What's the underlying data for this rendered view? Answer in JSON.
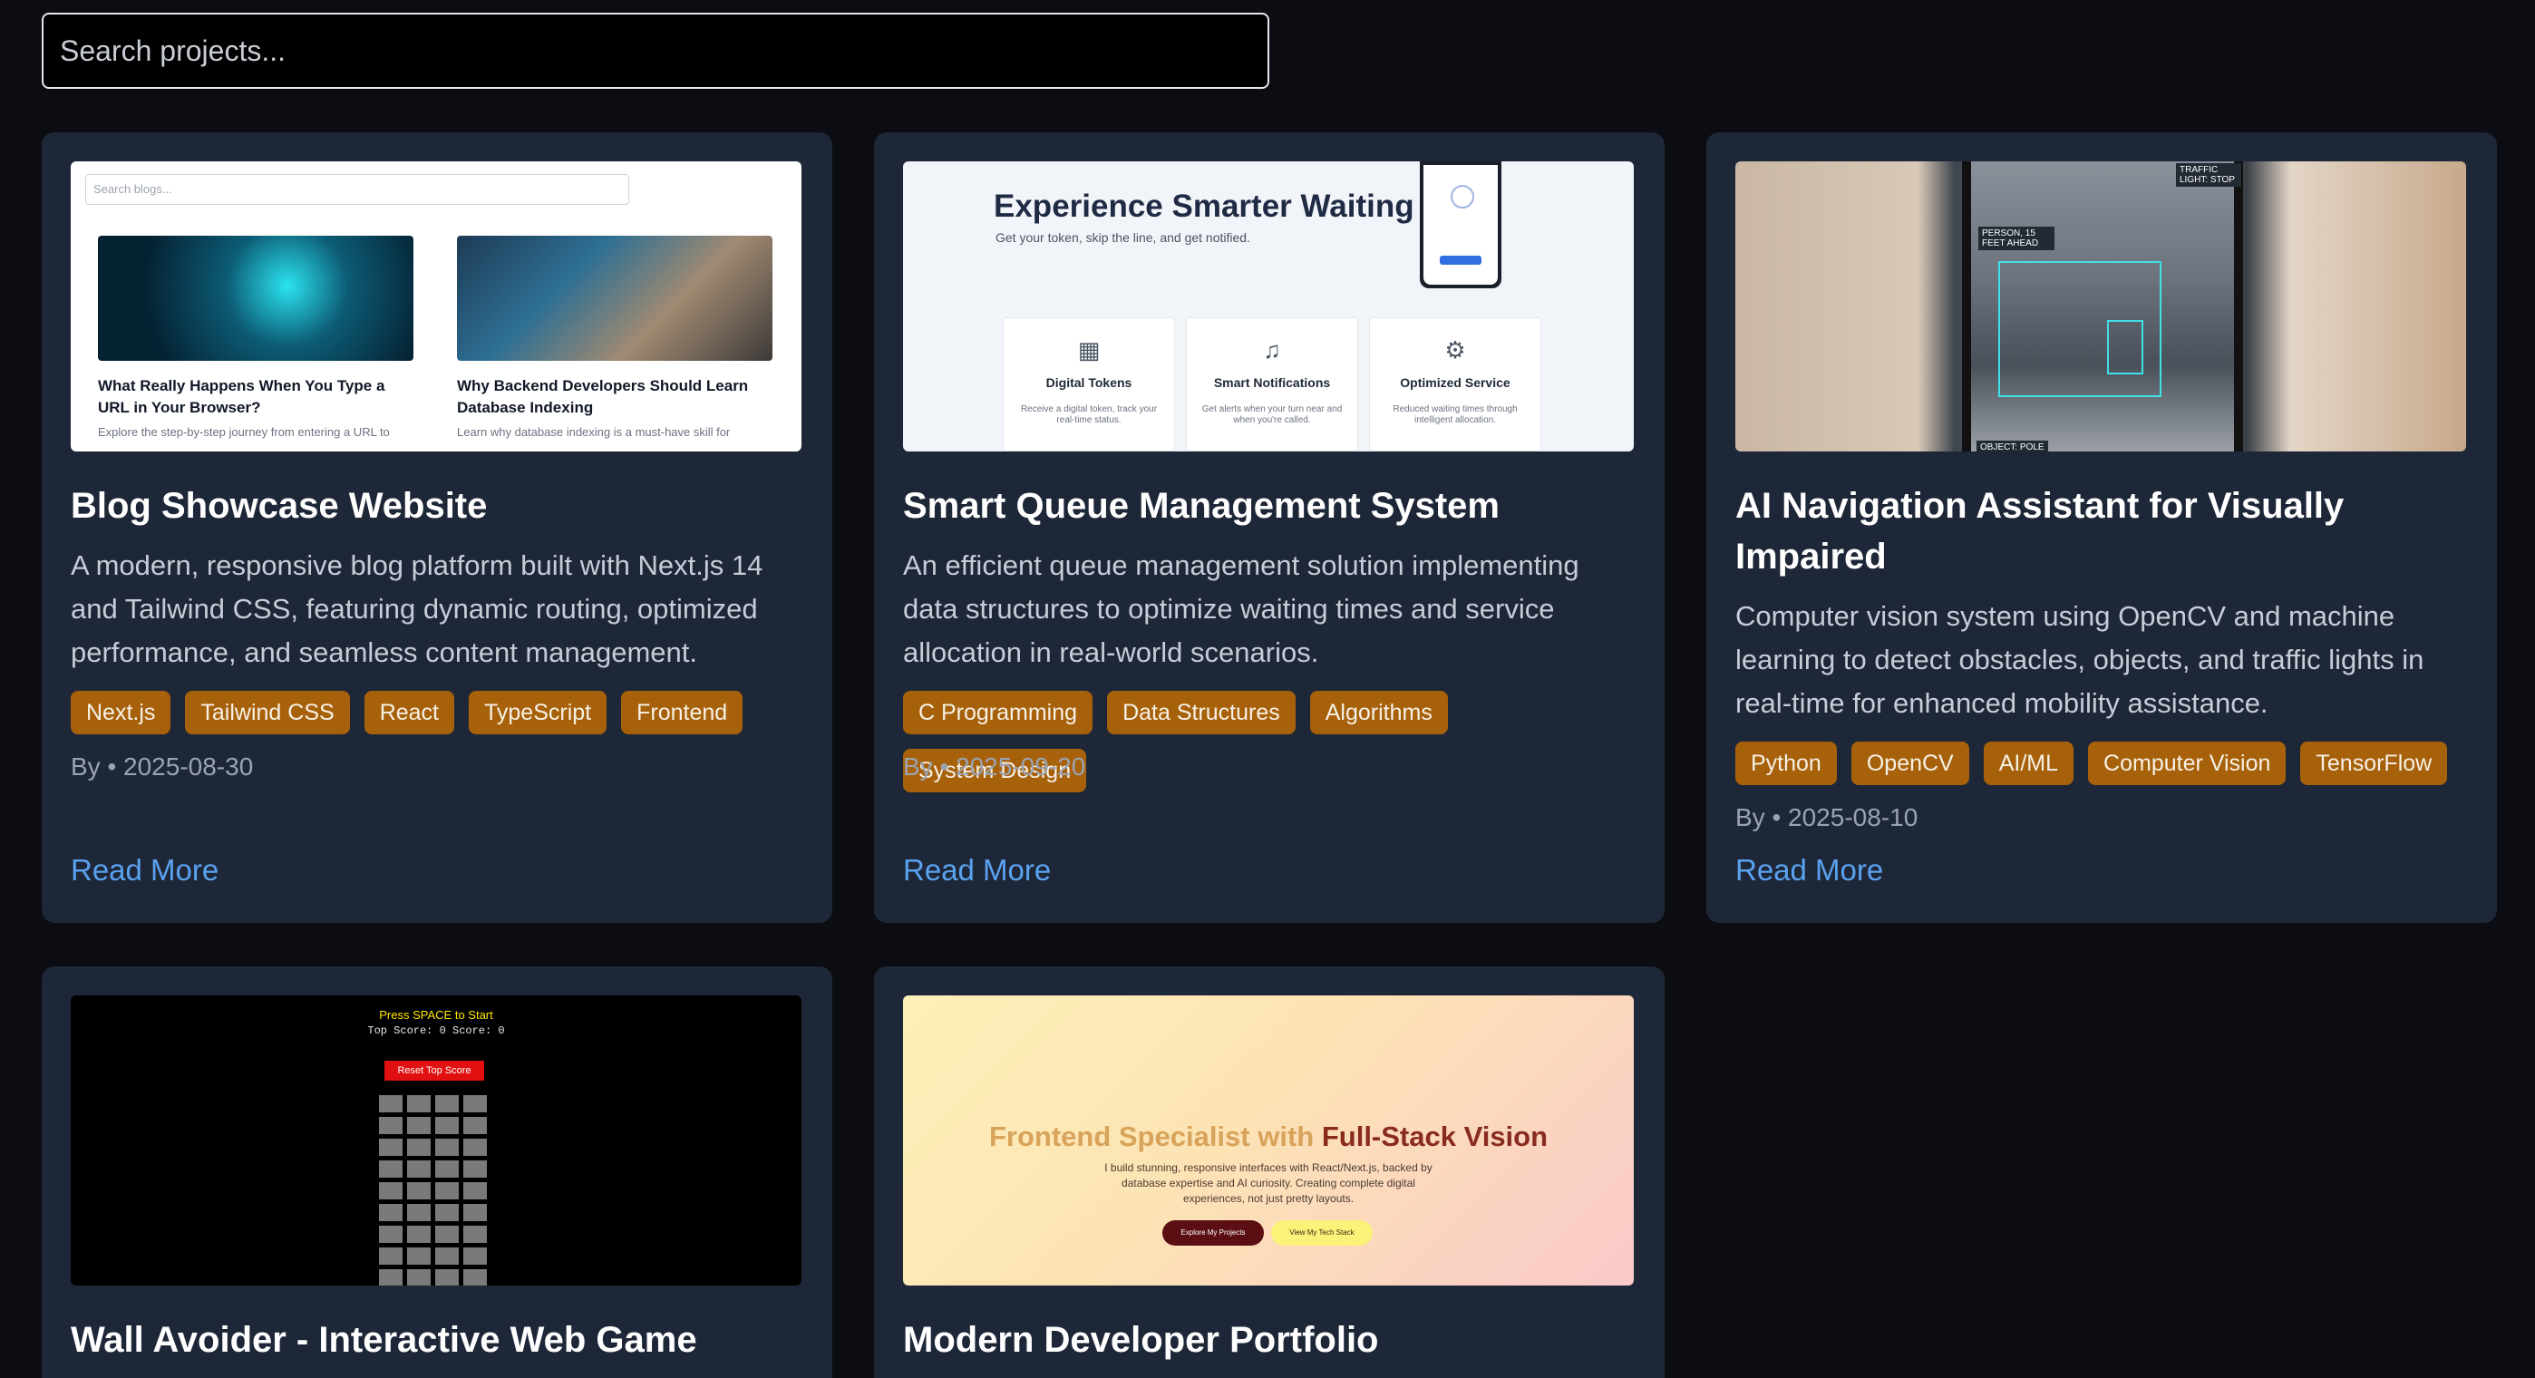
{
  "search": {
    "placeholder": "Search projects..."
  },
  "projects": [
    {
      "title": "Blog Showcase Website",
      "description": "A modern, responsive blog platform built with Next.js 14 and Tailwind CSS, featuring dynamic routing, optimized performance, and seamless content management.",
      "tags": [
        "Next.js",
        "Tailwind CSS",
        "React",
        "TypeScript",
        "Frontend"
      ],
      "meta": "By • 2025-08-30",
      "read_more": "Read More",
      "thumb": {
        "search": "Search blogs...",
        "post1_title": "What Really Happens When You Type a URL in Your Browser?",
        "post1_text": "Explore the step-by-step journey from entering a URL to",
        "post2_title": "Why Backend Developers Should Learn Database Indexing",
        "post2_text": "Learn why database indexing is a must-have skill for"
      }
    },
    {
      "title": "Smart Queue Management System",
      "description": "An efficient queue management solution implementing data structures to optimize waiting times and service allocation in real-world scenarios.",
      "tags": [
        "C Programming",
        "Data Structures",
        "Algorithms",
        "System Design"
      ],
      "meta": "By • 2025-09-20",
      "read_more": "Read More",
      "thumb": {
        "heading": "Experience Smarter Waiting",
        "sub": "Get your token, skip the line, and get notified.",
        "f1_title": "Digital Tokens",
        "f1_text": "Receive a digital token, track your real-time status.",
        "f2_title": "Smart Notifications",
        "f2_text": "Get alerts when your turn near and when you're called.",
        "f3_title": "Optimized Service",
        "f3_text": "Reduced waiting times through intelligent allocation."
      }
    },
    {
      "title": "AI Navigation Assistant for Visually Impaired",
      "description": "Computer vision system using OpenCV and machine learning to detect obstacles, objects, and traffic lights in real-time for enhanced mobility assistance.",
      "tags": [
        "Python",
        "OpenCV",
        "AI/ML",
        "Computer Vision",
        "TensorFlow"
      ],
      "meta": "By • 2025-08-10",
      "read_more": "Read More",
      "thumb": {
        "label_person": "PERSON, 15 FEET AHEAD",
        "label_light": "TRAFFIC LIGHT: STOP",
        "label_object": "OBJECT: POLE"
      }
    },
    {
      "title": "Wall Avoider - Interactive Web Game",
      "thumb": {
        "start": "Press SPACE to Start",
        "score": "Top Score: 0   Score: 0",
        "reset": "Reset Top Score"
      }
    },
    {
      "title": "Modern Developer Portfolio",
      "thumb": {
        "heading_a": "Frontend Specialist with ",
        "heading_b": "Full-Stack Vision",
        "sub": "I build stunning, responsive interfaces with React/Next.js, backed by database expertise and AI curiosity. Creating complete digital experiences, not just pretty layouts.",
        "btn1": "Explore My Projects",
        "btn2": "View My Tech Stack"
      }
    }
  ]
}
